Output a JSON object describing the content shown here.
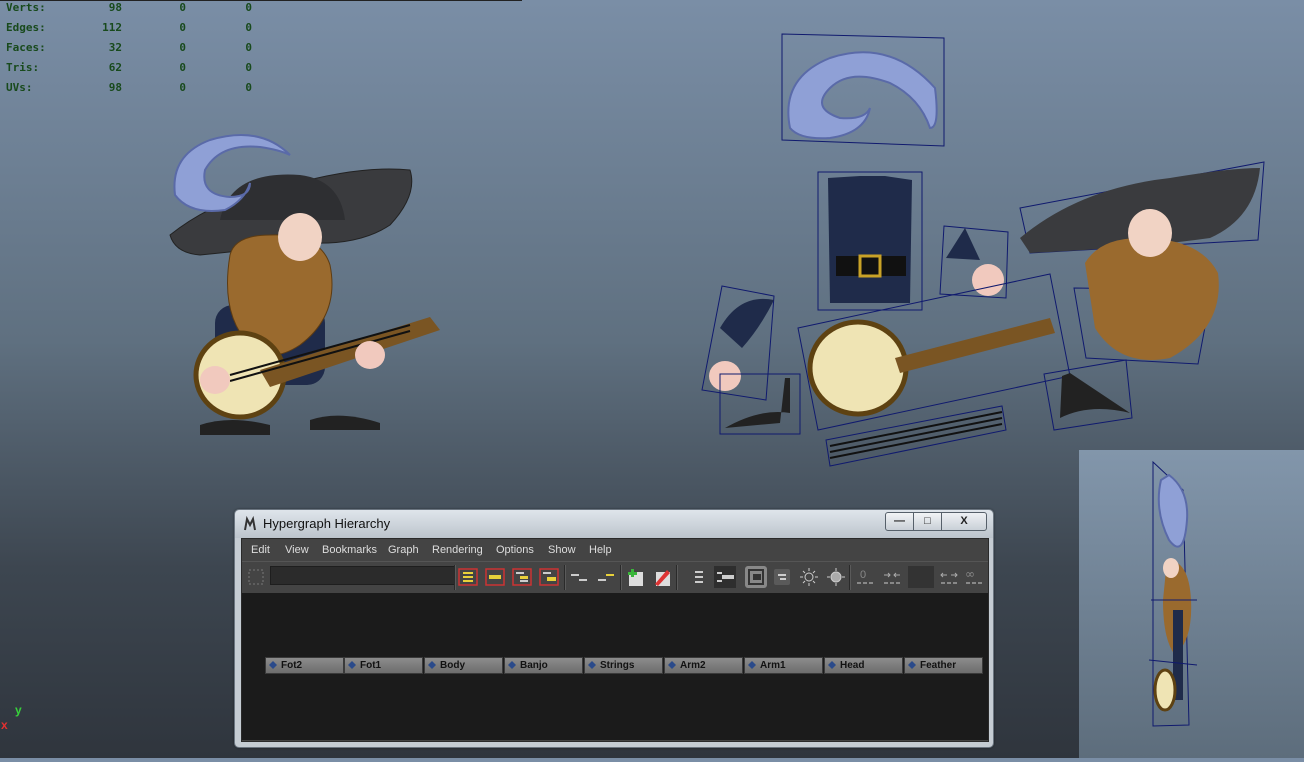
{
  "hud": {
    "rows": [
      {
        "label": "Verts:",
        "v1": "98",
        "v2": "0",
        "v3": "0"
      },
      {
        "label": "Edges:",
        "v1": "112",
        "v2": "0",
        "v3": "0"
      },
      {
        "label": "Faces:",
        "v1": "32",
        "v2": "0",
        "v3": "0"
      },
      {
        "label": "Tris:",
        "v1": "62",
        "v2": "0",
        "v3": "0"
      },
      {
        "label": "UVs:",
        "v1": "98",
        "v2": "0",
        "v3": "0"
      }
    ]
  },
  "axis": {
    "y": "y",
    "x": "x"
  },
  "colors": {
    "hud_text": "#184a1c",
    "selection_wire": "#101a6e",
    "axis_x": "#e43030",
    "axis_y": "#37d23a"
  },
  "window": {
    "title": "Hypergraph Hierarchy",
    "min_label": "—",
    "max_label": "□",
    "close_label": "X",
    "menu": [
      "Edit",
      "View",
      "Bookmarks",
      "Graph",
      "Rendering",
      "Options",
      "Show",
      "Help"
    ],
    "search_value": "",
    "toolbar_icons": [
      "frame-all-icon",
      "frame-selection-icon",
      "frame-hierarchy-icon",
      "frame-branch-icon",
      "previous-view-icon",
      "next-view-icon",
      "add-bookmark-icon",
      "edit-bookmark-icon",
      "simple-mode-icon",
      "scene-hierarchy-icon",
      "input-output-icon",
      "output-icon",
      "expand-icon",
      "collapse-icon",
      "swatch-icon",
      "link-icon"
    ],
    "nodes": [
      "Fot2",
      "Fot1",
      "Body",
      "Banjo",
      "Strings",
      "Arm2",
      "Arm1",
      "Head",
      "Feather"
    ]
  }
}
